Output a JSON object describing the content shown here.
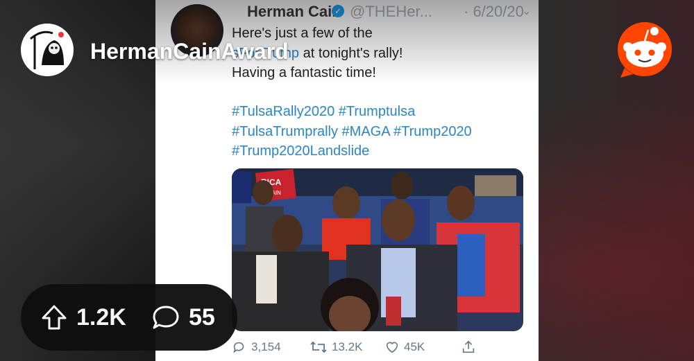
{
  "subreddit": {
    "name": "HermanCainAward",
    "icon": "grim-reaper-icon"
  },
  "brand": {
    "logo": "reddit-snoo-icon",
    "accent": "#ff4500"
  },
  "tweet": {
    "author_name": "Herman Cain",
    "handle": "@THEHer...",
    "date": "· 6/20/20",
    "text_line1": "Here's just a few of the",
    "text_line2_tag": "sForTrump",
    "text_line2_rest": " at tonight's rally!",
    "text_line3": "Having a fantastic time!",
    "hashtags": [
      "#TulsaRally2020 #Trumptulsa",
      "#TulsaTrumprally #MAGA #Trump2020",
      "#Trump2020Landslide"
    ],
    "replies": "3,154",
    "retweets": "13.2K",
    "likes": "45K",
    "sign_text": "RICA\nAGAIN"
  },
  "stats": {
    "upvotes": "1.2K",
    "comments": "55"
  }
}
